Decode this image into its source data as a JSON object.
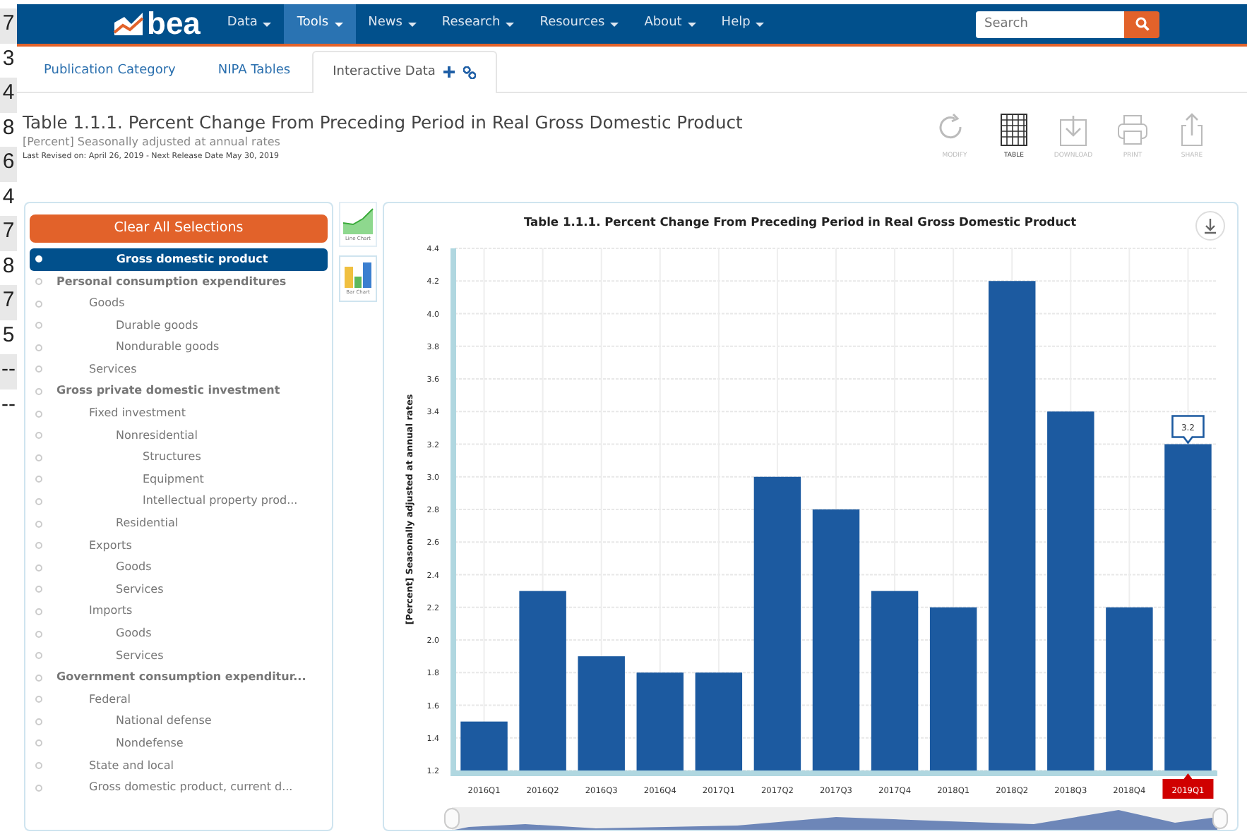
{
  "left_strip": [
    "7",
    "3",
    "4",
    "8",
    "6",
    "4",
    "7",
    "8",
    "7",
    "5",
    "--",
    "--"
  ],
  "navbar": {
    "logo": "bea",
    "items": [
      {
        "label": "Data",
        "selected": false
      },
      {
        "label": "Tools",
        "selected": true
      },
      {
        "label": "News",
        "selected": false
      },
      {
        "label": "Research",
        "selected": false
      },
      {
        "label": "Resources",
        "selected": false
      },
      {
        "label": "About",
        "selected": false
      },
      {
        "label": "Help",
        "selected": false
      }
    ],
    "search": {
      "placeholder": "Search"
    }
  },
  "tabs": [
    {
      "label": "Publication Category",
      "selected": false
    },
    {
      "label": "NIPA Tables",
      "selected": false
    },
    {
      "label": "Interactive Data",
      "selected": true
    }
  ],
  "header": {
    "title": "Table 1.1.1. Percent Change From Preceding Period in Real Gross Domestic Product",
    "subtitle": "[Percent] Seasonally adjusted at annual rates",
    "revised": "Last Revised on: April 26, 2019 - Next Release Date May 30, 2019"
  },
  "toolbar": [
    {
      "kind": "modify",
      "label": "MODIFY",
      "selected": false
    },
    {
      "kind": "table",
      "label": "TABLE",
      "selected": true
    },
    {
      "kind": "download",
      "label": "DOWNLOAD",
      "selected": false
    },
    {
      "kind": "print",
      "label": "PRINT",
      "selected": false
    },
    {
      "kind": "share",
      "label": "SHARE",
      "selected": false
    }
  ],
  "sidebar": {
    "clear_button": "Clear All Selections",
    "items": [
      {
        "label": "Gross domestic product",
        "selected": true
      },
      {
        "label": "Personal consumption expenditures",
        "selected": false,
        "children": [
          {
            "label": "Goods",
            "selected": false,
            "children": [
              {
                "label": "Durable goods",
                "selected": false
              },
              {
                "label": "Nondurable goods",
                "selected": false
              }
            ]
          },
          {
            "label": "Services",
            "selected": false
          }
        ]
      },
      {
        "label": "Gross private domestic investment",
        "selected": false,
        "children": [
          {
            "label": "Fixed investment",
            "selected": false,
            "children": [
              {
                "label": "Nonresidential",
                "selected": false,
                "children": [
                  {
                    "label": "Structures",
                    "selected": false
                  },
                  {
                    "label": "Equipment",
                    "selected": false
                  },
                  {
                    "label": "Intellectual property prod...",
                    "selected": false
                  }
                ]
              },
              {
                "label": "Residential",
                "selected": false
              }
            ]
          },
          {
            "label": "Exports",
            "selected": false,
            "children": [
              {
                "label": "Goods",
                "selected": false
              },
              {
                "label": "Services",
                "selected": false
              }
            ]
          },
          {
            "label": "Imports",
            "selected": false,
            "children": [
              {
                "label": "Goods",
                "selected": false
              },
              {
                "label": "Services",
                "selected": false
              }
            ]
          }
        ]
      },
      {
        "label": "Government consumption expenditur...",
        "selected": false,
        "children": [
          {
            "label": "Federal",
            "selected": false,
            "children": [
              {
                "label": "National defense",
                "selected": false
              },
              {
                "label": "Nondefense",
                "selected": false
              }
            ]
          },
          {
            "label": "State and local",
            "selected": false
          },
          {
            "label": "Gross domestic product, current d...",
            "selected": false
          }
        ]
      }
    ]
  },
  "chart_types": [
    {
      "kind": "line",
      "label": "Line Chart",
      "selected": false
    },
    {
      "kind": "bar",
      "label": "Bar Chart",
      "selected": true
    }
  ],
  "chart": {
    "chart_data": {
      "type": "bar",
      "title": "Table 1.1.1. Percent Change From Preceding Period in Real Gross Domestic Product",
      "ylabel": "[Percent] Seasonally adjusted at annual rates",
      "categories": [
        "2016Q1",
        "2016Q2",
        "2016Q3",
        "2016Q4",
        "2017Q1",
        "2017Q2",
        "2017Q3",
        "2017Q4",
        "2018Q1",
        "2018Q2",
        "2018Q3",
        "2018Q4",
        "2019Q1"
      ],
      "series": [
        {
          "color": "#1c5aa0",
          "values": [
            1.5,
            2.3,
            1.9,
            1.8,
            1.8,
            3.0,
            2.8,
            2.3,
            2.2,
            4.2,
            3.4,
            2.2,
            3.2
          ]
        }
      ],
      "ylim": [
        1.2,
        4.4
      ],
      "yticks": [
        {
          "value": 1.2,
          "label": "1.2"
        },
        {
          "value": 1.4,
          "label": "1.4"
        },
        {
          "value": 1.6,
          "label": "1.6"
        },
        {
          "value": 1.8,
          "label": "1.8"
        },
        {
          "value": 2.0,
          "label": "2.0"
        },
        {
          "value": 2.2,
          "label": "2.2"
        },
        {
          "value": 2.4,
          "label": "2.4"
        },
        {
          "value": 2.6,
          "label": "2.6"
        },
        {
          "value": 2.8,
          "label": "2.8"
        },
        {
          "value": 3.0,
          "label": "3.0"
        },
        {
          "value": 3.2,
          "label": "3.2"
        },
        {
          "value": 3.4,
          "label": "3.4"
        },
        {
          "value": 3.6,
          "label": "3.6"
        },
        {
          "value": 3.8,
          "label": "3.8"
        },
        {
          "value": 4.0,
          "label": "4.0"
        },
        {
          "value": 4.2,
          "label": "4.2"
        },
        {
          "value": 4.4,
          "label": "4.4"
        }
      ],
      "grid": true,
      "annotations": [
        {
          "x": "2019Q1",
          "text": "3.2"
        }
      ]
    }
  }
}
